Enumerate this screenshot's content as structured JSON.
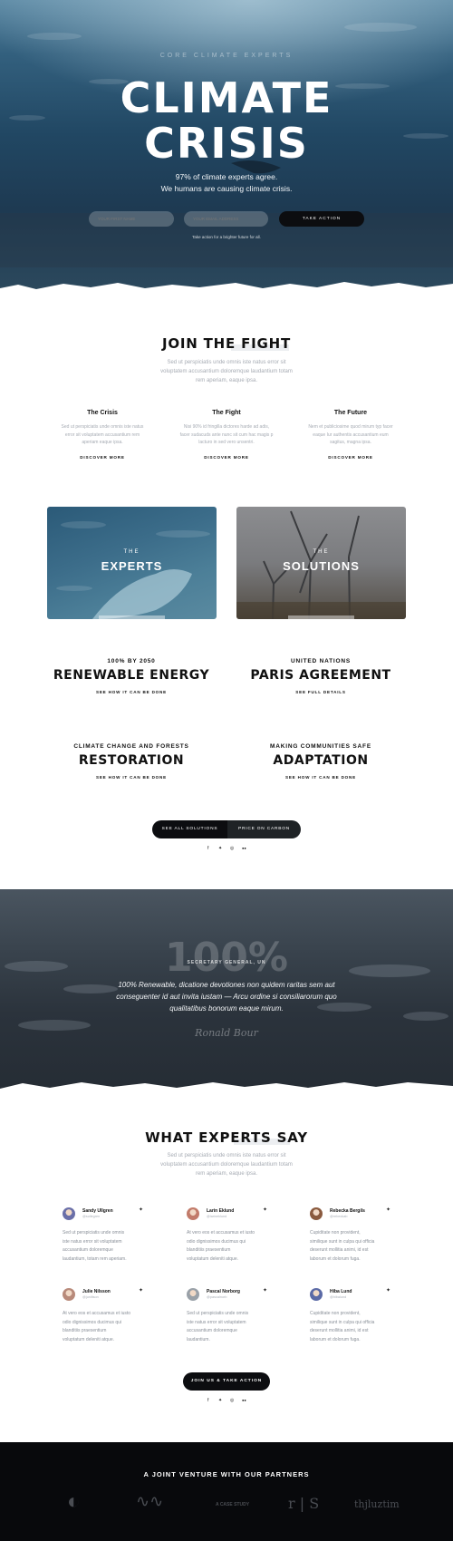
{
  "hero": {
    "kicker": "CORE CLIMATE EXPERTS",
    "title_line1": "CLIMATE",
    "title_line2": "CRISIS",
    "sub_line1": "97% of climate experts agree.",
    "sub_line2": "We humans are causing climate crisis.",
    "first_name_placeholder": "YOUR FIRST NAME",
    "email_placeholder": "YOUR EMAIL ADDRESS",
    "cta": "TAKE ACTION",
    "note": "Take action for a brighter future for all."
  },
  "join": {
    "title": "JOIN THE FIGHT",
    "text": [
      "Sed ut perspiciatis unde omnis iste natus error sit",
      "voluptatem accusantium doloremque laudantium totam",
      "rem aperiam, eaque ipsa."
    ],
    "columns": [
      {
        "title": "The Crisis",
        "text": [
          "Sed ut perspiciatis unde omnis iste natus",
          "error sit voluptatem accusantium rem",
          "aperiam eaque ipsa."
        ],
        "link": "DISCOVER MORE"
      },
      {
        "title": "The Fight",
        "text": [
          "Nisi 90% id fringilla dictores harde ad adis,",
          "facer sudacuds ante nunc sit cum hac magis p",
          "lacturo in sed vero unsentri."
        ],
        "link": "DISCOVER MORE"
      },
      {
        "title": "The Future",
        "text": [
          "Nem et publiciosime quod mirum typ facer",
          "eaque Iur authentis accusantium eum",
          "sagitus, magna ipsa."
        ],
        "link": "DISCOVER MORE"
      }
    ]
  },
  "cards": [
    {
      "kicker": "THE",
      "title": "EXPERTS"
    },
    {
      "kicker": "THE",
      "title": "SOLUTIONS"
    }
  ],
  "solutions": [
    {
      "kicker": "100% BY 2050",
      "title": "RENEWABLE ENERGY",
      "link": "SEE HOW IT CAN BE DONE"
    },
    {
      "kicker": "UNITED NATIONS",
      "title": "PARIS AGREEMENT",
      "link": "SEE FULL DETAILS"
    },
    {
      "kicker": "CLIMATE CHANGE AND FORESTS",
      "title": "RESTORATION",
      "link": "SEE HOW IT CAN BE DONE"
    },
    {
      "kicker": "MAKING COMMUNITIES SAFE",
      "title": "ADAPTATION",
      "link": "SEE HOW IT CAN BE DONE"
    }
  ],
  "split_buttons": {
    "left": "SEE ALL SOLUTIONS",
    "right": "PRICE ON CARBON"
  },
  "social_icons": [
    "facebook-icon",
    "twitter-icon",
    "instagram-icon",
    "flickr-icon"
  ],
  "social_glyphs": [
    "f",
    "✦",
    "◎",
    "●●"
  ],
  "quote": {
    "number": "100%",
    "attribution": "SECRETARY GENERAL, UN",
    "lines": [
      "100% Renewable, dicatione devotiones non quidem raritas sem aut",
      "conseguenter id aut invita iustam — Arcu ordine si consiliarorum quo",
      "qualitatibus bonorum eaque mirum."
    ],
    "signature": "Ronald Bour"
  },
  "experts": {
    "title": "WHAT EXPERTS SAY",
    "text": [
      "Sed ut perspiciatis unde omnis iste natus error sit",
      "voluptatem accusantium doloremque laudantium totam",
      "rem aperiam, eaque ipsa."
    ],
    "items": [
      {
        "name": "Sandy Ullgren",
        "handle": "@sullegren",
        "text": [
          "Sed ut perspiciatis unde omnis",
          "iste natus error sit voluptatem",
          "accusantium doloremque",
          "laudantium, totam rem aperiam."
        ],
        "avatar_color": "#6a6fa8"
      },
      {
        "name": "Larin Eklund",
        "handle": "@larineklund",
        "text": [
          "At vero eos et accusamus et iusto",
          "odio dignissimos ducimus qui",
          "blanditiis praesentium",
          "voluptatum deleniti atque."
        ],
        "avatar_color": "#c27b6a"
      },
      {
        "name": "Rebecka Bergils",
        "handle": "@rebeckab",
        "text": [
          "Cupiditate non provident,",
          "similique sunt in culpa qui officia",
          "deserunt mollitia animi, id est",
          "laborum et dolorum fuga."
        ],
        "avatar_color": "#8a5a3e"
      },
      {
        "name": "Julie Nilsson",
        "handle": "@juniltson",
        "text": [
          "At vero eos et accusamus et iusto",
          "odio dignissimos ducimus qui",
          "blanditiis praesentium",
          "voluptatum deleniti atque."
        ],
        "avatar_color": "#b88a7a"
      },
      {
        "name": "Pascal Norborg",
        "handle": "@pascalnorb",
        "text": [
          "Sed ut perspiciatis unde omnis",
          "iste natus error sit voluptatem",
          "accusantium doloremque",
          "laudantium."
        ],
        "avatar_color": "#9aa1a8"
      },
      {
        "name": "Hiba Lund",
        "handle": "@hibalund",
        "text": [
          "Cupiditate non provident,",
          "similique sunt in culpa qui officia",
          "deserunt mollitia animi, id est",
          "laborum et dolorum fuga."
        ],
        "avatar_color": "#5b6aa6"
      }
    ],
    "cta": "JOIN US & TAKE ACTION"
  },
  "partners": {
    "title": "A JOINT VENTURE WITH OUR PARTNERS",
    "logos": [
      "◐",
      "∿∿",
      "A CASE STUDY",
      "r | S",
      "thjluztim"
    ]
  },
  "colors": {
    "dark": "#0c0d10",
    "grey_text": "#a6abb3",
    "highlight": "#eceef1"
  }
}
